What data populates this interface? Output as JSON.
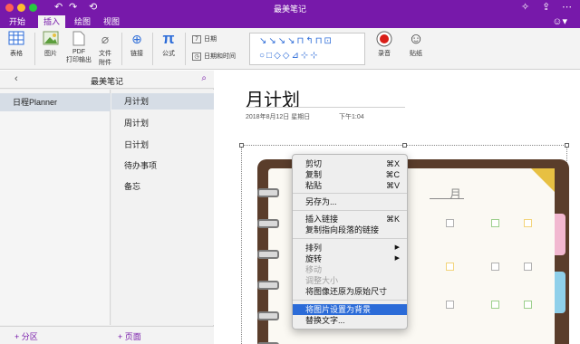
{
  "app": {
    "title": "最美笔记"
  },
  "colors": {
    "accent": "#7719aa",
    "highlight": "#2b6bd8"
  },
  "ribbon": {
    "tabs": [
      {
        "label": "开始",
        "active": false
      },
      {
        "label": "插入",
        "active": true
      },
      {
        "label": "绘图",
        "active": false
      },
      {
        "label": "视图",
        "active": false
      }
    ],
    "buttons": {
      "table": "表格",
      "picture": "图片",
      "pdf_line1": "PDF",
      "pdf_line2": "打印输出",
      "file_line1": "文件",
      "file_line2": "附件",
      "link": "链接",
      "equation": "公式",
      "date": "日期",
      "date_time": "日期和时间",
      "record": "录音",
      "sticker": "贴纸"
    },
    "ink_row1": "↘↘↘↘⊓↰⊓⊡",
    "ink_row2": "○□◇◇⊿⊹⊹"
  },
  "sidebar": {
    "notebook_title": "最美笔记",
    "sections": [
      {
        "label": "日程Planner",
        "selected": true
      }
    ],
    "pages": [
      {
        "label": "月计划",
        "selected": true
      },
      {
        "label": "周计划",
        "selected": false
      },
      {
        "label": "日计划",
        "selected": false
      },
      {
        "label": "待办事项",
        "selected": false
      },
      {
        "label": "备忘",
        "selected": false
      }
    ],
    "add_section": "+ 分区",
    "add_page": "+ 页面"
  },
  "page": {
    "title": "月计划",
    "date": "2018年8月12日  星期日",
    "time": "下午1:04"
  },
  "planner": {
    "month_suffix": "月"
  },
  "context_menu": {
    "items": [
      {
        "label": "剪切",
        "shortcut": "⌘X",
        "disabled": false
      },
      {
        "label": "复制",
        "shortcut": "⌘C",
        "disabled": false
      },
      {
        "label": "粘贴",
        "shortcut": "⌘V",
        "disabled": false
      },
      {
        "label": "另存为...",
        "shortcut": "",
        "disabled": false
      },
      {
        "label": "插入链接",
        "shortcut": "⌘K",
        "disabled": false
      },
      {
        "label": "复制指向段落的链接",
        "shortcut": "",
        "disabled": false
      },
      {
        "label": "排列",
        "submenu": true,
        "disabled": false
      },
      {
        "label": "旋转",
        "submenu": true,
        "disabled": false
      },
      {
        "label": "移动",
        "shortcut": "",
        "disabled": true
      },
      {
        "label": "调整大小",
        "shortcut": "",
        "disabled": true
      },
      {
        "label": "将图像还原为原始尺寸",
        "shortcut": "",
        "disabled": false
      },
      {
        "label": "将图片设置为背景",
        "shortcut": "",
        "disabled": false,
        "highlighted": true
      },
      {
        "label": "替换文字...",
        "shortcut": "",
        "disabled": false
      }
    ]
  }
}
